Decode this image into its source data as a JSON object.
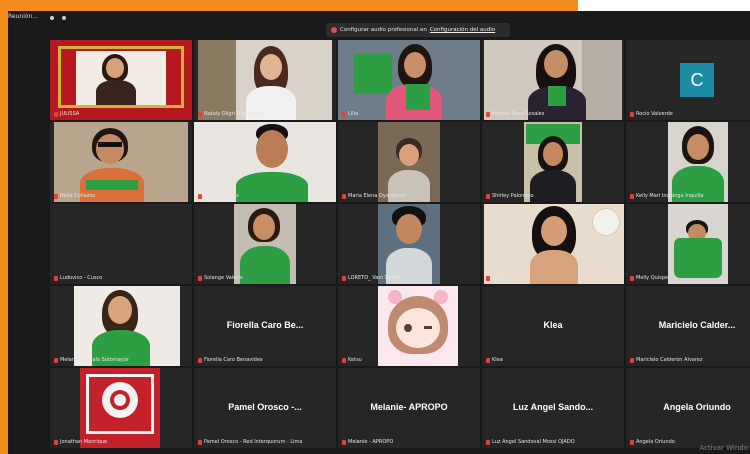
{
  "window": {
    "title": "Reunión..."
  },
  "notice": {
    "text": "Configurar audio profesional en",
    "link": "Configuración del audio"
  },
  "tiles": [
    {
      "id": "t1",
      "name": "JULISSA",
      "type": "video",
      "active": true
    },
    {
      "id": "t2",
      "name": "Nataly Dilgrí Geo-Paucar",
      "type": "video"
    },
    {
      "id": "t3",
      "name": "Lilia",
      "type": "video"
    },
    {
      "id": "t4",
      "name": "Fiorella Baca Rosales",
      "type": "video"
    },
    {
      "id": "t5",
      "name": "Rocío Valverde",
      "type": "avatar",
      "initial": "C"
    },
    {
      "id": "t6",
      "name": "Nella Collazos",
      "type": "video"
    },
    {
      "id": "t7",
      "name": "Jonas Paredes",
      "type": "video"
    },
    {
      "id": "t8",
      "name": "Maria Elena Oyanguren",
      "type": "video"
    },
    {
      "id": "t9",
      "name": "Shirley Palomino",
      "type": "video"
    },
    {
      "id": "t10",
      "name": "Kelly Mari Inquinga Inquilla",
      "type": "video"
    },
    {
      "id": "t11",
      "name": "Ludovico - Cusco",
      "type": "blank"
    },
    {
      "id": "t12",
      "name": "Solange Valerio",
      "type": "video"
    },
    {
      "id": "t13",
      "name": "LORETO_ Vani Dávila",
      "type": "video"
    },
    {
      "id": "t14",
      "name": "Aela",
      "type": "video"
    },
    {
      "id": "t15",
      "name": "Melly Quispe",
      "type": "video"
    },
    {
      "id": "t16",
      "name": "Melanie Arévalo Sotomayor",
      "type": "video"
    },
    {
      "id": "t17",
      "name": "Fiorella Caro Benavides",
      "type": "name",
      "display": "Fiorella Caro Be..."
    },
    {
      "id": "t18",
      "name": "Ketsu",
      "type": "video"
    },
    {
      "id": "t19",
      "name": "Klea",
      "type": "name",
      "display": "Klea"
    },
    {
      "id": "t20",
      "name": "Maricielo Calderón Álvarez",
      "type": "name",
      "display": "Maricielo Calder..."
    },
    {
      "id": "t21",
      "name": "Jonathan Manrique",
      "type": "video"
    },
    {
      "id": "t22",
      "name": "Pamel Orosco - Red Interquorum - Lima",
      "type": "name",
      "display": "Pamel Orosco -..."
    },
    {
      "id": "t23",
      "name": "Melanie - APROPO",
      "type": "name",
      "display": "Melanie- APROPO"
    },
    {
      "id": "t24",
      "name": "Luz Angel Sandoval Mossi OJADO",
      "type": "name",
      "display": "Luz Angel Sando..."
    },
    {
      "id": "t25",
      "name": "Angela Oriundo",
      "type": "name",
      "display": "Angela Oriundo"
    }
  ],
  "watermark": "Activar Windo",
  "colors": {
    "accent_orange": "#f28a1d",
    "active_border": "#e3c34f",
    "background": "#1a1a1a",
    "tile": "#262626",
    "avatar": "#1b8ca3",
    "mic_muted": "#e3413b",
    "scarf_green": "#2e9e45"
  }
}
